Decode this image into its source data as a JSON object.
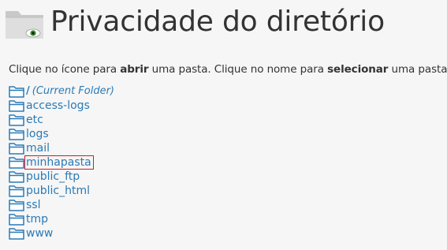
{
  "header": {
    "title": "Privacidade do diretório",
    "icon": "folder-eye-icon"
  },
  "instructions": {
    "part1": "Clique no ícone para ",
    "bold1": "abrir",
    "part2": " uma pasta. Clique no nome para ",
    "bold2": "selecionar",
    "part3": " uma pasta."
  },
  "colors": {
    "link": "#2a7ab6",
    "selected_outline": "#c81e2b",
    "eye": "#3a8f2a"
  },
  "folders": {
    "current": {
      "slash": "/",
      "label": "(Current Folder)"
    },
    "items": [
      {
        "label": "access-logs"
      },
      {
        "label": "etc"
      },
      {
        "label": "logs"
      },
      {
        "label": "mail"
      },
      {
        "label": "minhapasta",
        "selected": true
      },
      {
        "label": "public_ftp"
      },
      {
        "label": "public_html"
      },
      {
        "label": "ssl"
      },
      {
        "label": "tmp"
      },
      {
        "label": "www"
      }
    ]
  }
}
